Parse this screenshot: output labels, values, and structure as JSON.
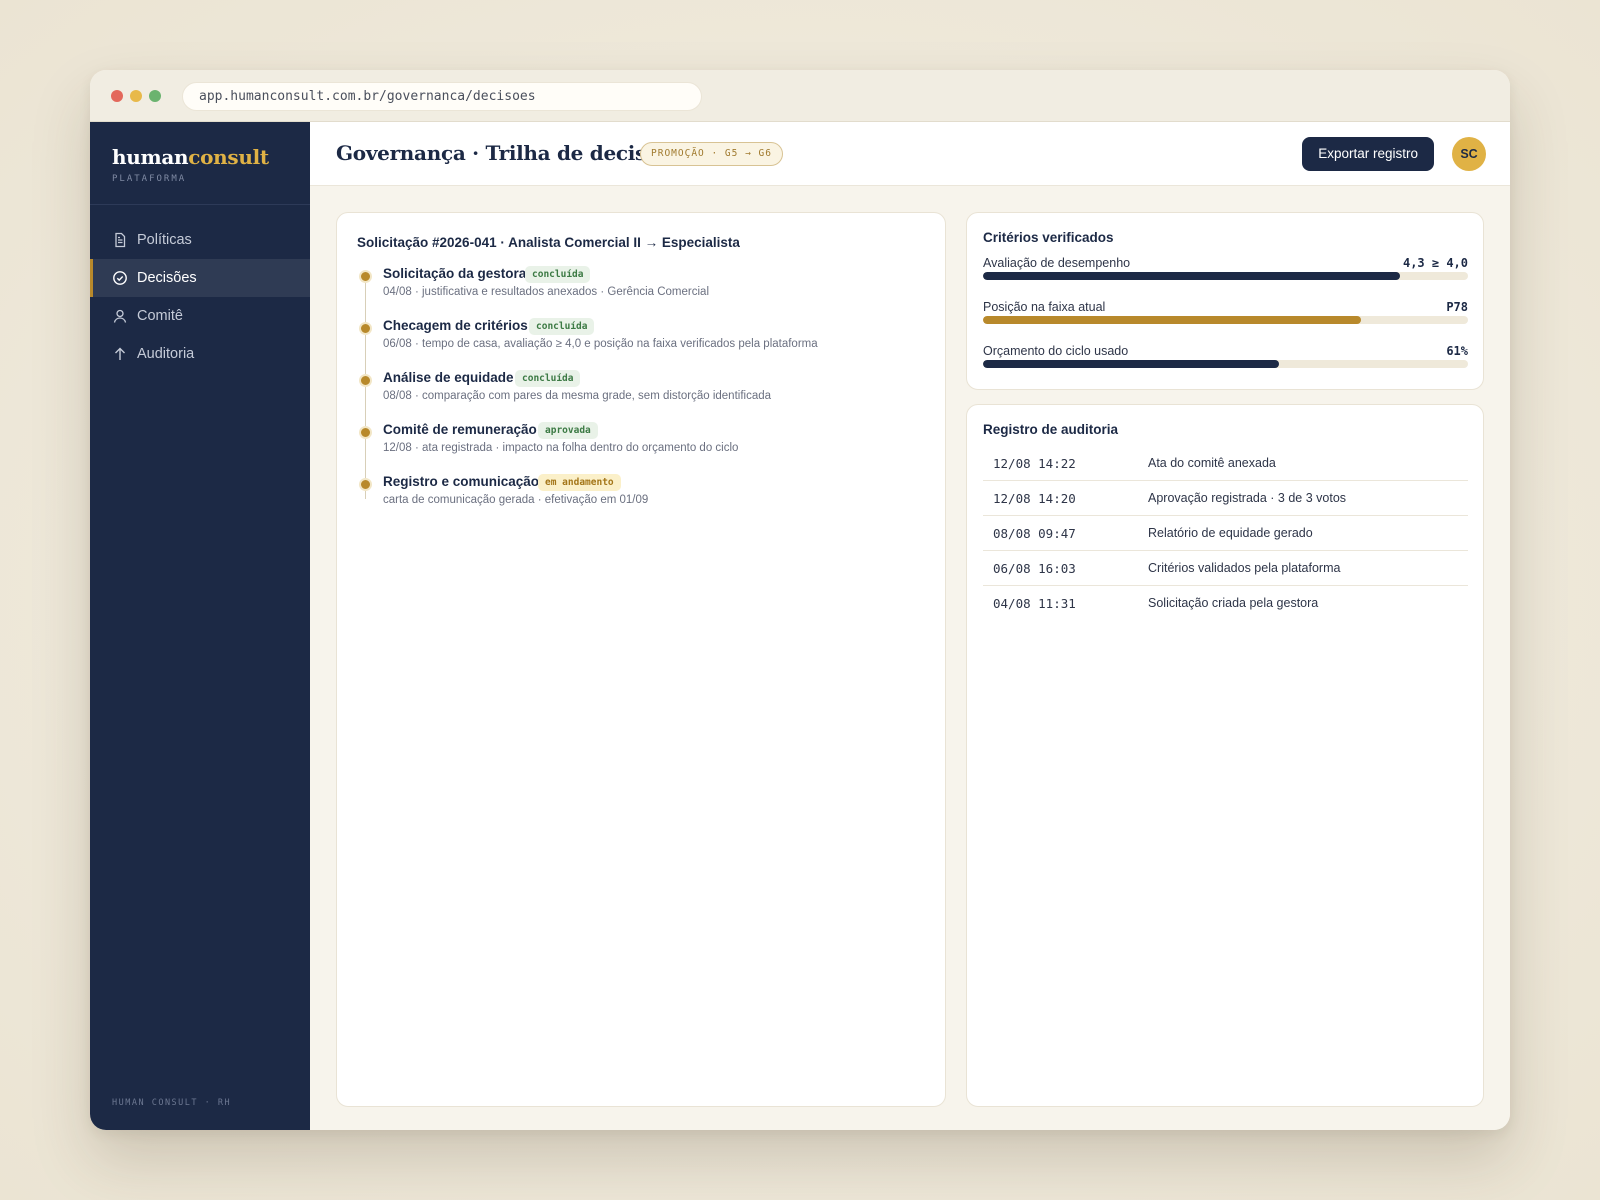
{
  "browser": {
    "url": "app.humanconsult.com.br/governanca/decisoes"
  },
  "sidebar": {
    "brand_primary": "human",
    "brand_accent": "consult",
    "brand_sub": "PLATAFORMA",
    "items": [
      {
        "label": "Políticas",
        "icon": "document-icon",
        "active": false
      },
      {
        "label": "Decisões",
        "icon": "check-circle-icon",
        "active": true
      },
      {
        "label": "Comitê",
        "icon": "user-icon",
        "active": false
      },
      {
        "label": "Auditoria",
        "icon": "arrow-up-icon",
        "active": false
      }
    ],
    "footer": "HUMAN CONSULT · RH"
  },
  "header": {
    "title": "Governança · Trilha de decisão",
    "pill": "PROMOÇÃO · G5 → G6",
    "export_label": "Exportar registro",
    "avatar_initials": "SC"
  },
  "request": {
    "title": "Solicitação #2026-041 · Analista Comercial II → Especialista",
    "steps": [
      {
        "title": "Solicitação da gestora",
        "badge": "concluída",
        "status": "done",
        "desc": "04/08 · justificativa e resultados anexados · Gerência Comercial"
      },
      {
        "title": "Checagem de critérios",
        "badge": "concluída",
        "status": "done",
        "desc": "06/08 · tempo de casa, avaliação ≥ 4,0 e posição na faixa verificados pela plataforma"
      },
      {
        "title": "Análise de equidade",
        "badge": "concluída",
        "status": "done",
        "desc": "08/08 · comparação com pares da mesma grade, sem distorção identificada"
      },
      {
        "title": "Comitê de remuneração",
        "badge": "aprovada",
        "status": "done",
        "desc": "12/08 · ata registrada · impacto na folha dentro do orçamento do ciclo"
      },
      {
        "title": "Registro e comunicação",
        "badge": "em andamento",
        "status": "progress",
        "desc": "carta de comunicação gerada · efetivação em 01/09"
      }
    ]
  },
  "criteria": {
    "heading": "Critérios verificados",
    "items": [
      {
        "label": "Avaliação de desempenho",
        "value": "4,3 ≥ 4,0",
        "fill": 0.86,
        "color": "#1c2945"
      },
      {
        "label": "Posição na faixa atual",
        "value": "P78",
        "fill": 0.78,
        "color": "#b8892b"
      },
      {
        "label": "Orçamento do ciclo usado",
        "value": "61%",
        "fill": 0.61,
        "color": "#1c2945"
      }
    ]
  },
  "audit": {
    "heading": "Registro de auditoria",
    "rows": [
      {
        "time": "12/08 14:22",
        "event": "Ata do comitê anexada"
      },
      {
        "time": "12/08 14:20",
        "event": "Aprovação registrada · 3 de 3 votos"
      },
      {
        "time": "08/08 09:47",
        "event": "Relatório de equidade gerado"
      },
      {
        "time": "06/08 16:03",
        "event": "Critérios validados pela plataforma"
      },
      {
        "time": "04/08 11:31",
        "event": "Solicitação criada pela gestora"
      }
    ]
  },
  "colors": {
    "navy": "#1c2945",
    "gold": "#b8892b",
    "avatar": "#e0b245",
    "done_badge": "#3c7a44",
    "progress_badge": "#a47619"
  }
}
